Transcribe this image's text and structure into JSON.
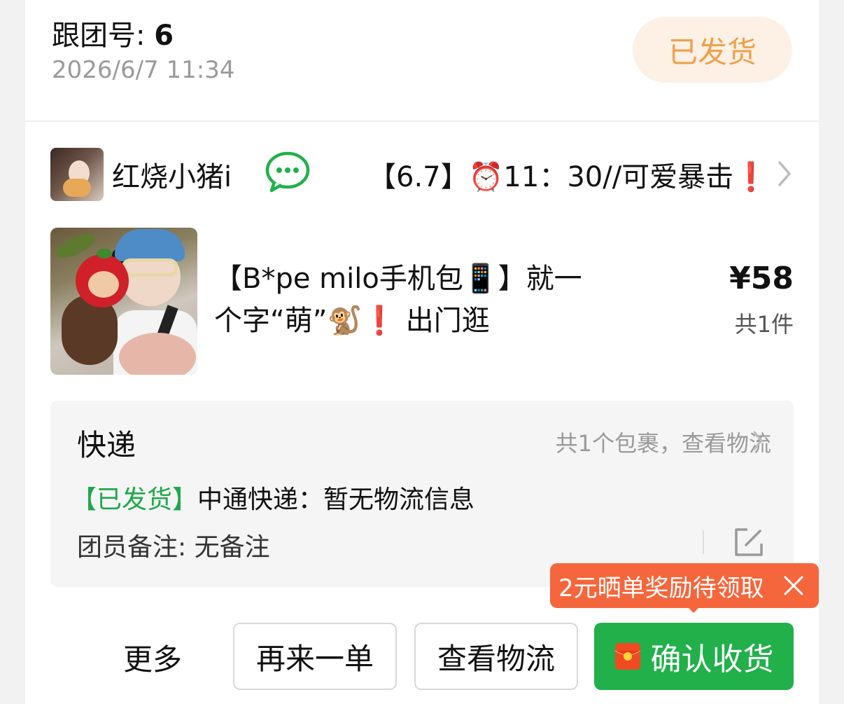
{
  "header": {
    "group_label": "跟团号:",
    "group_number": "6",
    "time": "2026/6/7 11:34",
    "status": "已发货"
  },
  "group": {
    "leader_name": "红烧小猪i",
    "title": "【6.7】⏰11：30//可爱暴击❗"
  },
  "product": {
    "title": "【B*pe milo手机包📱】就一个字“萌”🐒❗ 出门逛",
    "price": "¥58",
    "quantity": "共1件"
  },
  "shipping": {
    "label": "快递",
    "parcel_link": "共1个包裹，查看物流",
    "status_tag": "【已发货】",
    "status_text": "中通快递：暂无物流信息",
    "member_note": "团员备注: 无备注"
  },
  "reward_tip": "2元晒单奖励待领取",
  "actions": {
    "more": "更多",
    "reorder": "再来一单",
    "track": "查看物流",
    "confirm": "确认收货"
  },
  "colors": {
    "accent_green": "#22b04a",
    "status_orange": "#f0a04b",
    "tip_orange": "#f5663c"
  }
}
